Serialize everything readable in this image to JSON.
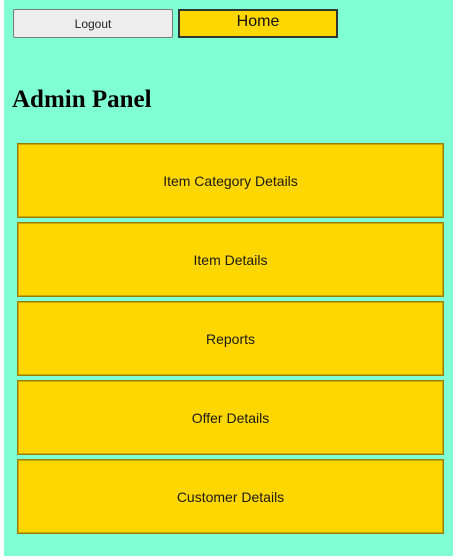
{
  "topbar": {
    "logout_label": "Logout",
    "home_label": "Home"
  },
  "page": {
    "title": "Admin Panel"
  },
  "menu": {
    "items": [
      {
        "label": "Item Category Details"
      },
      {
        "label": "Item Details"
      },
      {
        "label": "Reports"
      },
      {
        "label": "Offer Details"
      },
      {
        "label": "Customer Details"
      }
    ]
  },
  "colors": {
    "background": "#80ffd4",
    "menu_button": "#ffd700",
    "logout_button": "#ededed"
  }
}
